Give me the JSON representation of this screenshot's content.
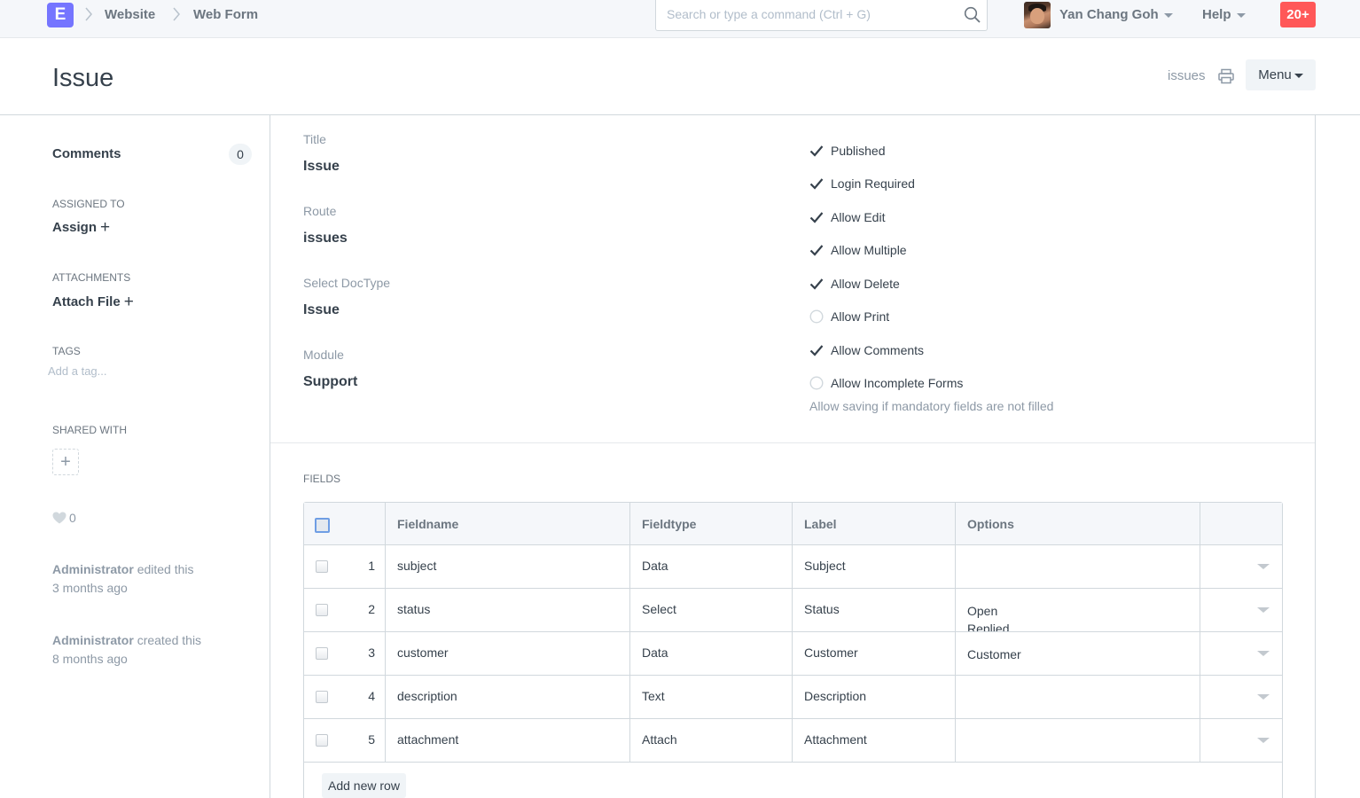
{
  "navbar": {
    "logo_letter": "E",
    "breadcrumbs": [
      "Website",
      "Web Form"
    ],
    "search_placeholder": "Search or type a command (Ctrl + G)",
    "user_name": "Yan Chang Goh",
    "help_label": "Help",
    "notifications": "20+"
  },
  "page": {
    "title": "Issue",
    "route_label": "issues",
    "menu_label": "Menu"
  },
  "sidebar": {
    "comments_label": "Comments",
    "comments_count": "0",
    "assigned_to_label": "ASSIGNED TO",
    "assign_label": "Assign",
    "attachments_label": "ATTACHMENTS",
    "attach_label": "Attach File",
    "tags_label": "TAGS",
    "tag_placeholder": "Add a tag...",
    "shared_with_label": "SHARED WITH",
    "likes": "0",
    "timeline": [
      {
        "user": "Administrator",
        "action": "edited this",
        "when": "3 months ago"
      },
      {
        "user": "Administrator",
        "action": "created this",
        "when": "8 months ago"
      }
    ]
  },
  "form": {
    "fields": [
      {
        "label": "Title",
        "value": "Issue"
      },
      {
        "label": "Route",
        "value": "issues"
      },
      {
        "label": "Select DocType",
        "value": "Issue"
      },
      {
        "label": "Module",
        "value": "Support"
      }
    ],
    "checks": [
      {
        "label": "Published",
        "checked": true
      },
      {
        "label": "Login Required",
        "checked": true
      },
      {
        "label": "Allow Edit",
        "checked": true
      },
      {
        "label": "Allow Multiple",
        "checked": true
      },
      {
        "label": "Allow Delete",
        "checked": true
      },
      {
        "label": "Allow Print",
        "checked": false
      },
      {
        "label": "Allow Comments",
        "checked": true
      },
      {
        "label": "Allow Incomplete Forms",
        "checked": false
      }
    ],
    "incomplete_help": "Allow saving if mandatory fields are not filled"
  },
  "fields_table": {
    "section_label": "FIELDS",
    "columns": [
      "Fieldname",
      "Fieldtype",
      "Label",
      "Options"
    ],
    "rows": [
      {
        "idx": "1",
        "fieldname": "subject",
        "fieldtype": "Data",
        "label": "Subject",
        "options": ""
      },
      {
        "idx": "2",
        "fieldname": "status",
        "fieldtype": "Select",
        "label": "Status",
        "options": "Open\nReplied"
      },
      {
        "idx": "3",
        "fieldname": "customer",
        "fieldtype": "Data",
        "label": "Customer",
        "options": "Customer"
      },
      {
        "idx": "4",
        "fieldname": "description",
        "fieldtype": "Text",
        "label": "Description",
        "options": ""
      },
      {
        "idx": "5",
        "fieldname": "attachment",
        "fieldtype": "Attach",
        "label": "Attachment",
        "options": ""
      }
    ],
    "add_row_label": "Add new row"
  },
  "colors": {
    "logo_bg": "#7575ff",
    "notification_bg": "#ff5858",
    "text": "#36414c",
    "muted": "#8d99a6"
  },
  "icons": {
    "search": "search-icon",
    "print": "print-icon",
    "heart": "heart-icon",
    "check": "check-icon",
    "caret": "chevron-down-icon"
  }
}
